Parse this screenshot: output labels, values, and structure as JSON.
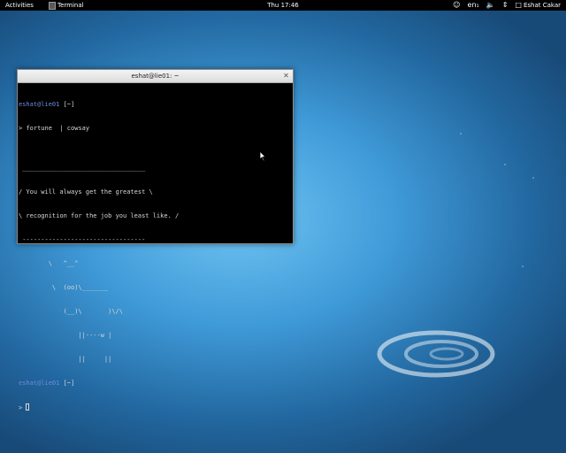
{
  "topbar": {
    "activities": "Activities",
    "app_name": "Terminal",
    "clock": "Thu 17:46",
    "keyboard_layout": "en₁",
    "user_name": "Eshat Cakar"
  },
  "terminal": {
    "title": "eshat@lie01: ~",
    "prompt_user": "eshat@lie01",
    "prompt_dir": " [~]",
    "prompt_symbol": "> ",
    "command": "fortune  | cowsay",
    "output": [
      "",
      " _________________________________",
      "/ You will always get the greatest \\",
      "\\ recognition for the job you least like. /",
      " ---------------------------------",
      "        \\   ^__^",
      "         \\  (oo)\\_______",
      "            (__)\\       )\\/\\",
      "                ||----w |",
      "                ||     ||"
    ]
  },
  "icons": {
    "accessibility": "accessibility-icon",
    "volume": "volume-icon",
    "network": "network-icon",
    "user": "user-icon"
  }
}
